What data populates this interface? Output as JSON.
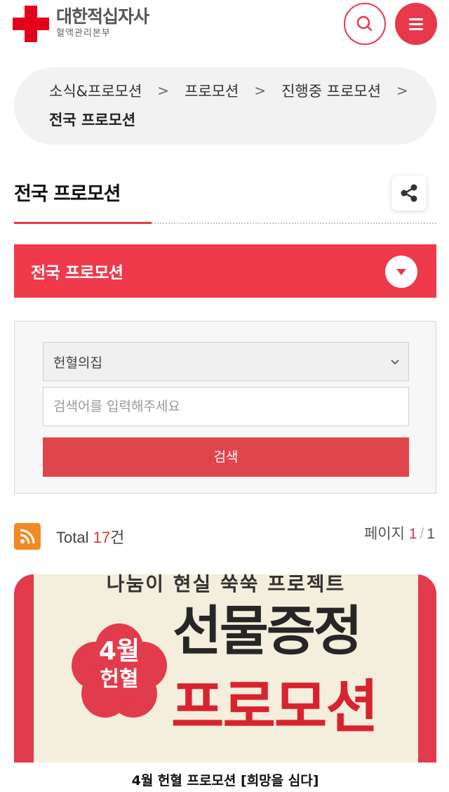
{
  "header": {
    "logo_title": "대한적십자사",
    "logo_subtitle": "혈액관리본부",
    "search_icon": "search-icon",
    "menu_icon": "hamburger-menu-icon",
    "brand_color": "#e3001b",
    "accent_color": "#e8394b"
  },
  "breadcrumb": {
    "items": [
      "소식&프로모션",
      "프로모션",
      "진행중 프로모션"
    ],
    "current": "전국 프로모션",
    "separator": ">"
  },
  "page": {
    "title": "전국 프로모션",
    "share_icon": "share-icon"
  },
  "category_select": {
    "label": "전국 프로모션",
    "toggle_icon": "caret-down-icon"
  },
  "search": {
    "select_value": "헌혈의집",
    "input_placeholder": "검색어를 입력해주세요",
    "submit_label": "검색"
  },
  "summary": {
    "total_label": "Total",
    "total_count": "17",
    "total_unit": "건",
    "page_label": "페이지",
    "page_current": "1",
    "page_total": "1",
    "rss_icon": "rss-icon"
  },
  "promotions": [
    {
      "banner_top": "나눔이 현실 쑥쑥 프로젝트",
      "badge_line1": "4월",
      "badge_line2": "헌혈",
      "headline1": "선물증정",
      "headline2": "프로모션",
      "caption": "4월 헌혈 프로모션 [희망을 심다]"
    }
  ]
}
